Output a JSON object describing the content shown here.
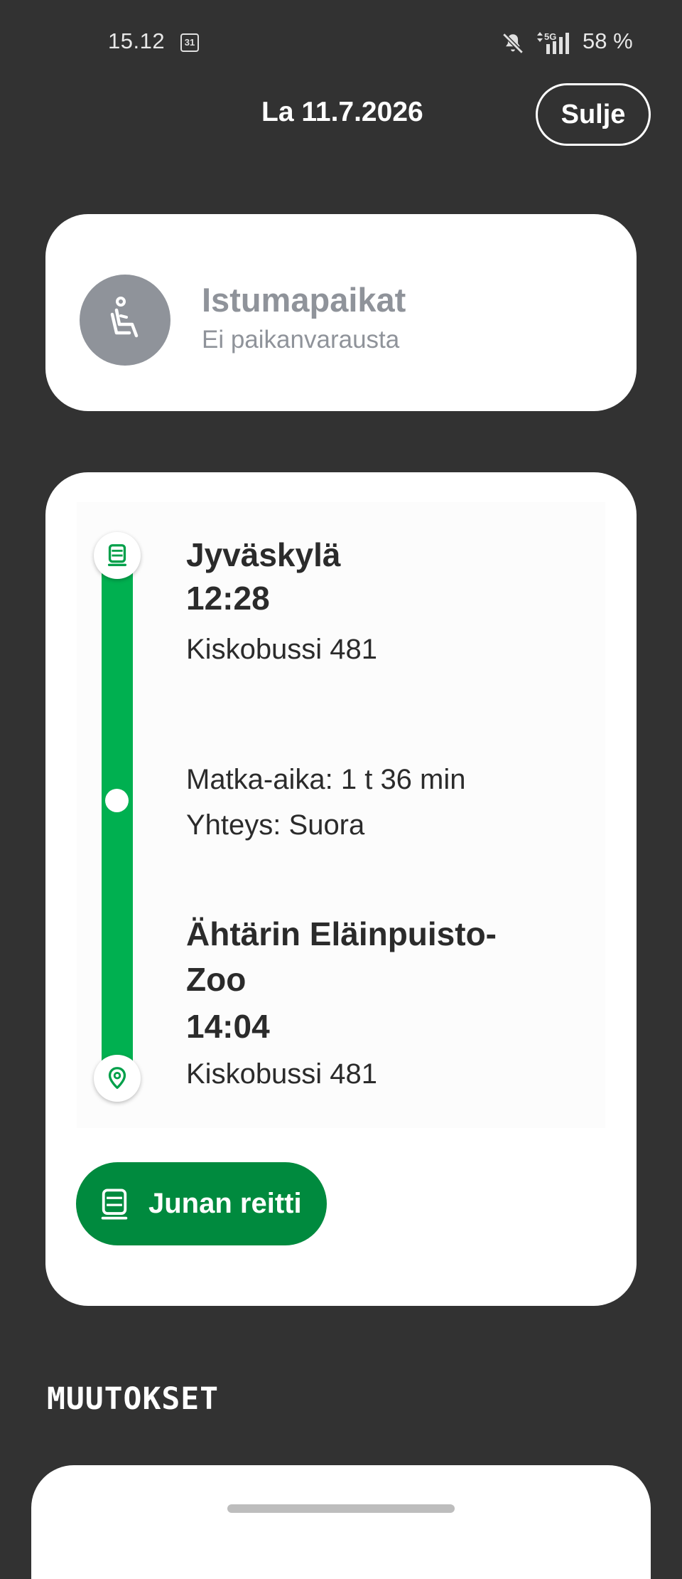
{
  "status_bar": {
    "time": "15.12",
    "calendar_day": "31",
    "network": "5G",
    "battery": "58 %"
  },
  "header": {
    "date": "La 11.7.2026",
    "close_label": "Sulje"
  },
  "seats": {
    "title": "Istumapaikat",
    "subtitle": "Ei paikanvarausta",
    "icon": "seat-icon"
  },
  "journey": {
    "departure": {
      "station": "Jyväskylä",
      "time": "12:28",
      "train": "Kiskobussi 481"
    },
    "duration": "Matka-aika: 1 t 36 min",
    "connection": "Yhteys: Suora",
    "arrival": {
      "station_line1": "Ähtärin Eläinpuisto-",
      "station_line2": "Zoo",
      "time": "14:04",
      "train": "Kiskobussi 481"
    },
    "route_button_label": "Junan reitti"
  },
  "changes": {
    "title": "MUUTOKSET"
  },
  "colors": {
    "background": "#323232",
    "card": "#ffffff",
    "route_green": "#00b050",
    "button_green": "#008a3e",
    "muted_gray": "#8f939a",
    "text_dark": "#2b2b2b"
  }
}
